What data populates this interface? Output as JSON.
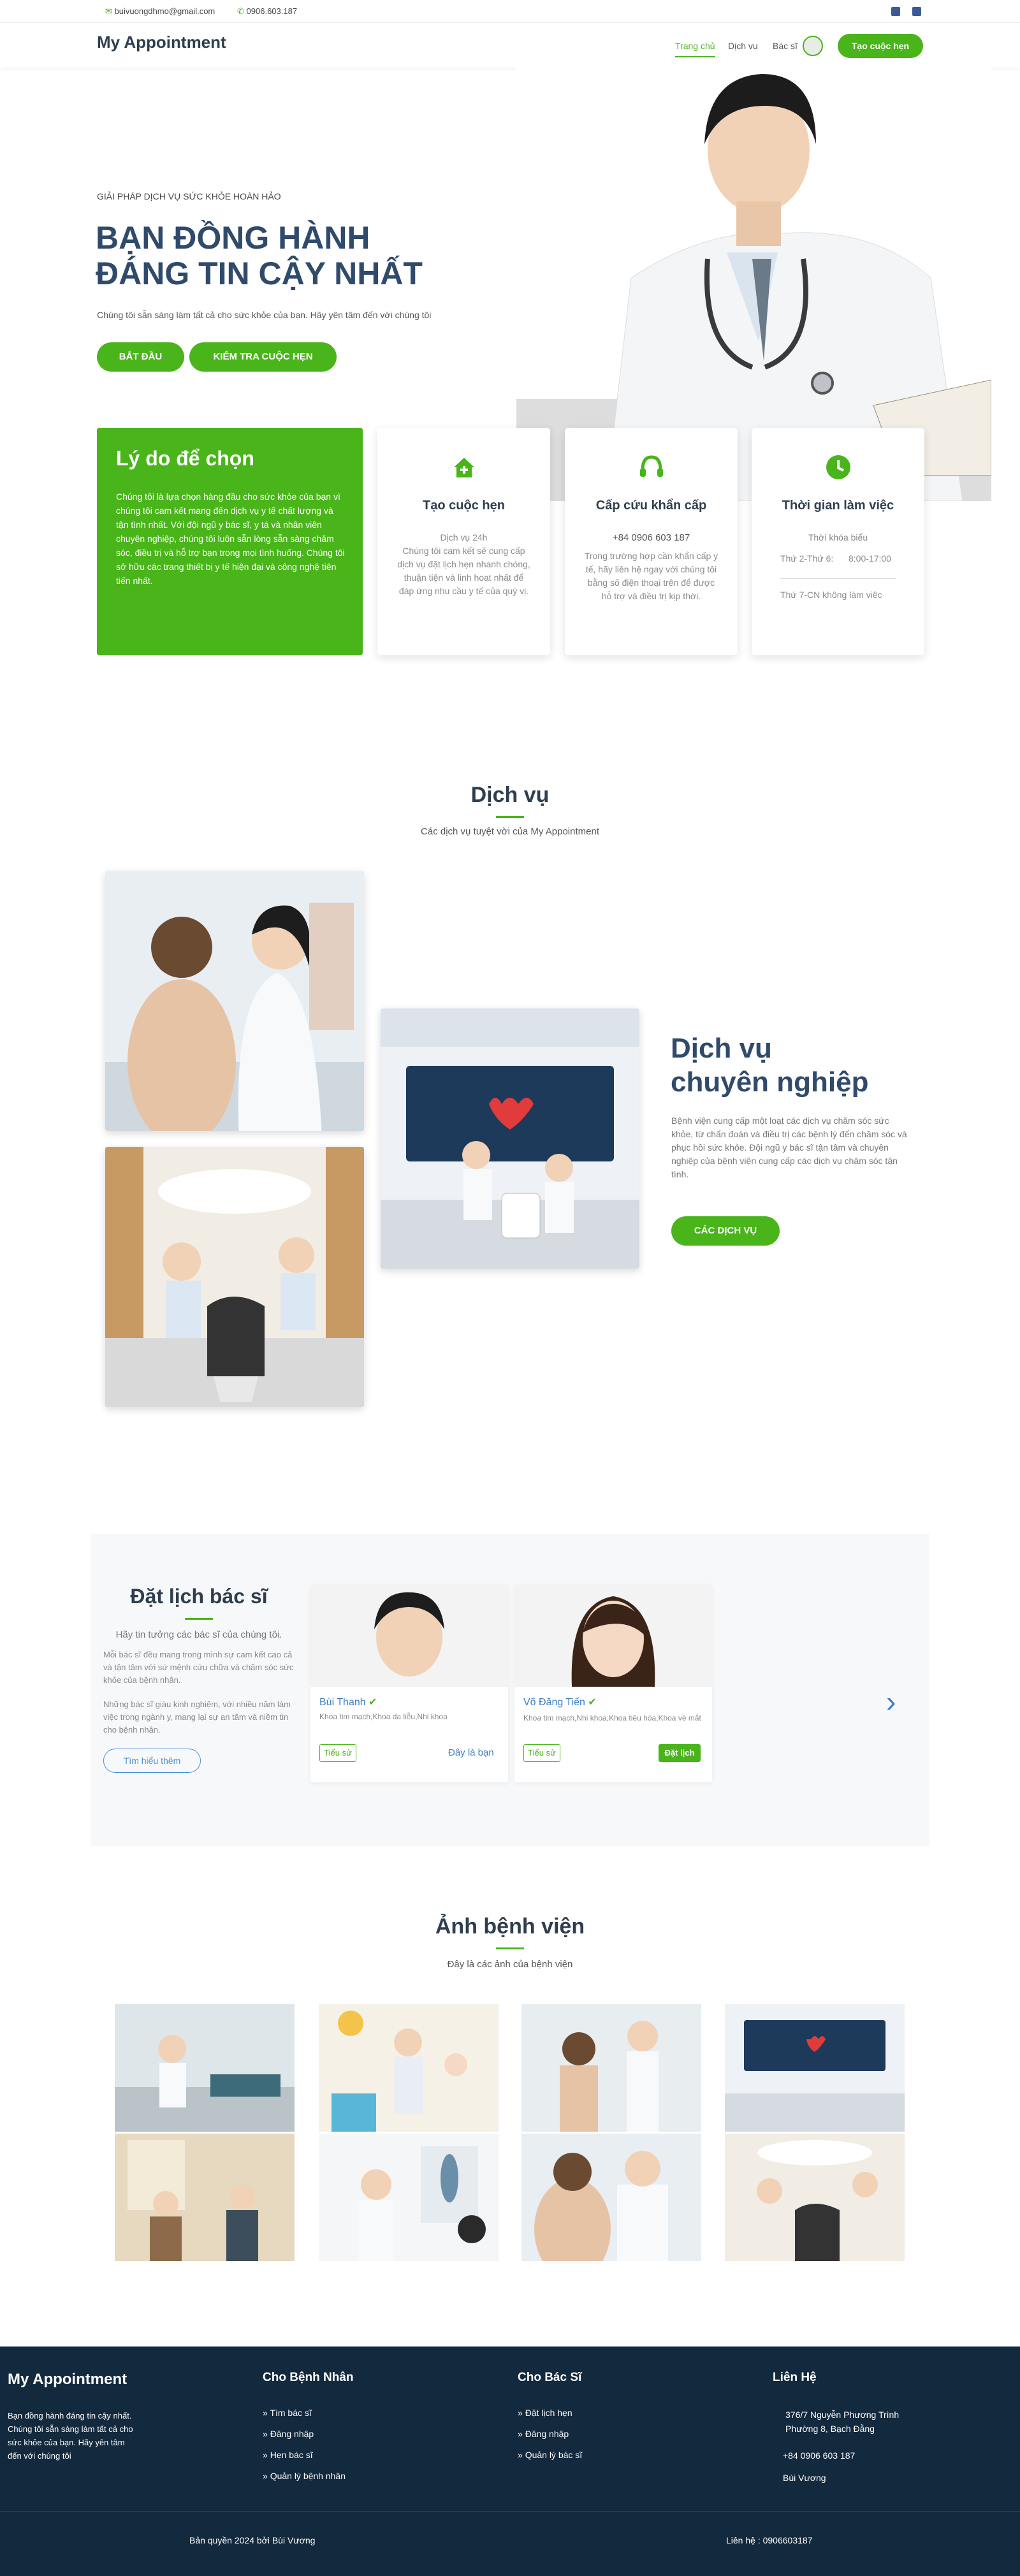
{
  "topbar": {
    "email": "buivuongdhmo@gmail.com",
    "phone": "0906.603.187"
  },
  "nav": {
    "brand": "My Appointment",
    "links": [
      "Trang chủ",
      "Dịch vụ",
      "Bác sĩ"
    ],
    "cta": "Tạo cuộc hẹn"
  },
  "hero": {
    "eyebrow": "GIẢI PHÁP DỊCH VỤ SỨC KHỎE HOÀN HẢO",
    "title_line1": "BẠN ĐỒNG HÀNH",
    "title_line2": "ĐÁNG TIN CẬY NHẤT",
    "subtitle": "Chúng tôi sẵn sàng làm tất cả cho sức khỏe của bạn. Hãy yên tâm đến với chúng tôi",
    "btn_start": "BẮT ĐẦU",
    "btn_check": "KIỂM TRA CUỘC HẸN"
  },
  "why": {
    "title": "Lý do để chọn",
    "body": "Chúng tôi là lựa chọn hàng đầu cho sức khỏe của bạn vì chúng tôi cam kết mang đến dịch vụ y tế chất lượng và tận tình nhất. Với đội ngũ y bác sĩ, y tá và nhân viên chuyên nghiệp, chúng tôi luôn sẵn lòng sẵn sàng chăm sóc, điều trị và hỗ trợ bạn trong mọi tình huống. Chúng tôi sở hữu các trang thiết bị y tế hiện đại và công nghệ tiên tiến nhất."
  },
  "cards": [
    {
      "icon": "home-plus-icon",
      "title": "Tạo cuộc hẹn",
      "sub": "Dịch vụ 24h",
      "body": "Chúng tôi cam kết sẽ cung cấp dịch vụ đặt lịch hẹn nhanh chóng, thuận tiện và linh hoạt nhất để đáp ứng nhu cầu y tế của quý vị."
    },
    {
      "icon": "headset-icon",
      "title": "Cấp cứu khẩn cấp",
      "sub": "+84 0906 603 187",
      "body": "Trong trường hợp cần khẩn cấp y tế, hãy liên hệ ngay với chúng tôi bằng số điện thoại trên để được hỗ trợ và điều trị kịp thời."
    },
    {
      "icon": "clock-icon",
      "title": "Thời gian làm việc",
      "sub": "Thời khóa biểu",
      "row1_label": "Thứ 2-Thứ 6:",
      "row1_value": "8:00-17:00",
      "row2": "Thứ 7-CN không làm việc"
    }
  ],
  "services": {
    "title": "Dịch vụ",
    "subtitle": "Các dịch vụ tuyệt vời của My Appointment",
    "heading_line1": "Dịch vụ",
    "heading_line2": "chuyên nghiệp",
    "body": "Bệnh viện cung cấp một loạt các dịch vụ chăm sóc sức khỏe, từ chẩn đoán và điều trị các bệnh lý đến chăm sóc và phục hồi sức khỏe. Đội ngũ y bác sĩ tận tâm và chuyên nghiệp của bệnh viện cung cấp các dịch vụ chăm sóc tận tình.",
    "btn": "CÁC DỊCH VỤ"
  },
  "doctors": {
    "title": "Đặt lịch bác sĩ",
    "lead": "Hãy tin tưởng các bác sĩ của chúng tôi.",
    "p1": "Mỗi bác sĩ đều mang trong mình sự cam kết cao cả và tận tâm với sứ mệnh cứu chữa và chăm sóc sức khỏe của bệnh nhân.",
    "p2": "Những bác sĩ giàu kinh nghiệm, với nhiều năm làm việc trong ngành y, mang lại sự an tâm và niềm tin cho bệnh nhân.",
    "more": "Tìm hiểu thêm",
    "list": [
      {
        "name": "Bùi Thanh",
        "spec": "Khoa tim mạch,Khoa da liễu,Nhi khoa",
        "btn_profile": "Tiểu sử",
        "action": "Đây là bạn"
      },
      {
        "name": "Võ Đăng Tiến",
        "spec": "Khoa tim mạch,Nhi khoa,Khoa tiêu hóa,Khoa về mắt",
        "btn_profile": "Tiểu sử",
        "action": "Đặt lịch"
      }
    ]
  },
  "gallery": {
    "title": "Ảnh bệnh viện",
    "subtitle": "Đây là các ảnh của bệnh viện"
  },
  "footer": {
    "brand": "My Appointment",
    "about": "Bạn đồng hành đáng tin cậy nhất. Chúng tôi sẵn sàng làm tất cả cho sức khỏe của bạn. Hãy yên tâm đến với chúng tôi",
    "col1_title": "Cho Bệnh Nhân",
    "col1": [
      "Tìm bác sĩ",
      "Đăng nhập",
      "Hẹn bác sĩ",
      "Quản lý bệnh nhân"
    ],
    "col2_title": "Cho Bác Sĩ",
    "col2": [
      "Đặt lịch hẹn",
      "Đăng nhập",
      "Quản lý bác sĩ"
    ],
    "col3_title": "Liên Hệ",
    "address_line1": "376/7 Nguyễn Phương Trình",
    "address_line2": "Phường 8, Bạch Đằng",
    "phone": "+84 0906 603 187",
    "name": "Bùi Vương",
    "copyright": "Bản quyền 2024 bởi Bùi Vương",
    "contact": "Liên hệ :  0906603187"
  }
}
